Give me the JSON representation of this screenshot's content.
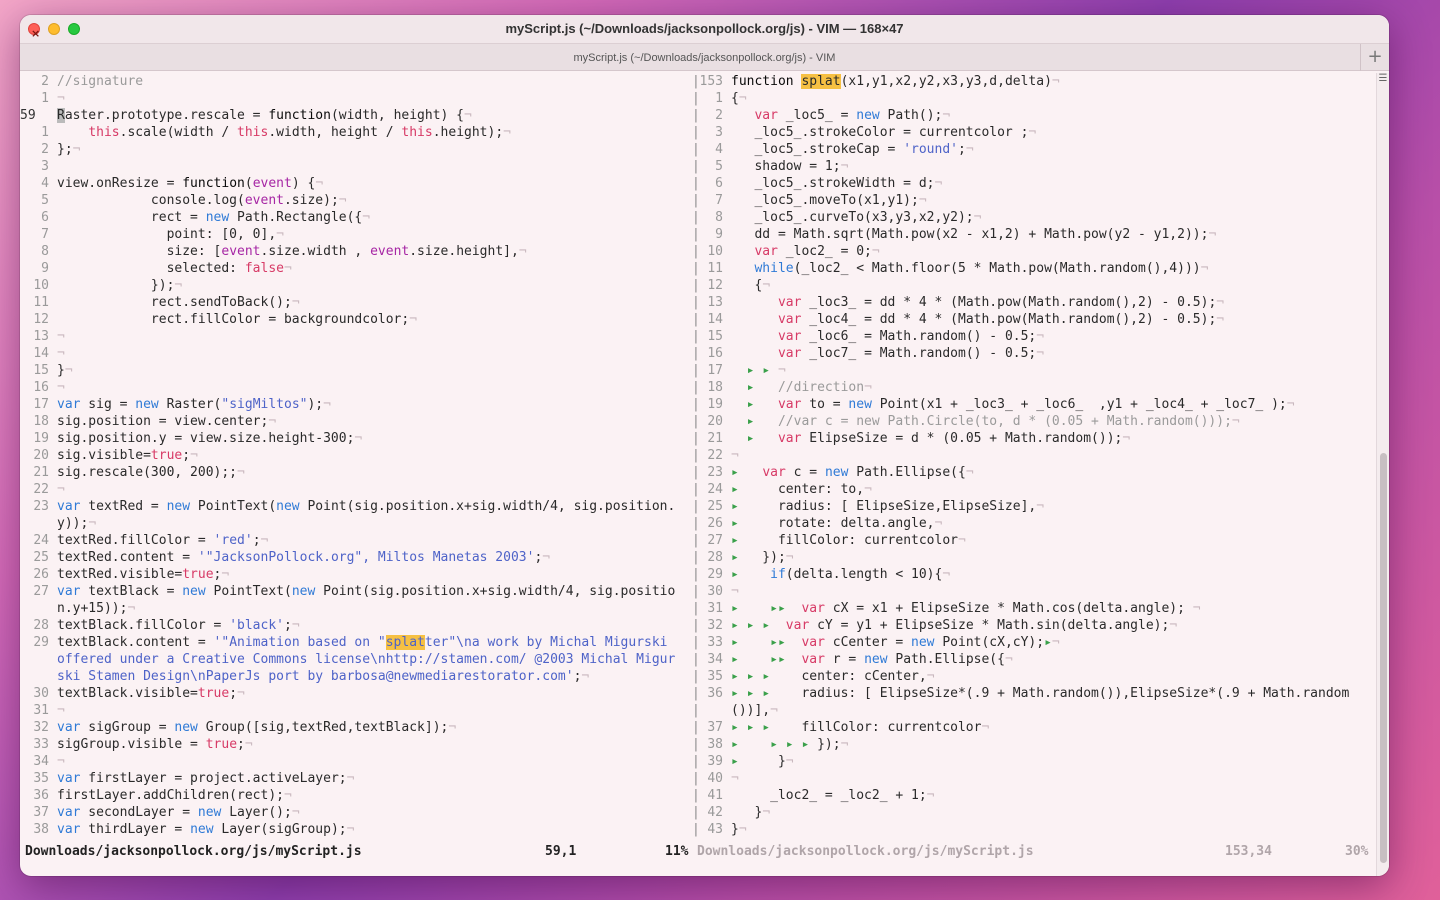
{
  "window": {
    "title": "myScript.js (~/Downloads/jacksonpollock.org/js) - VIM — 168×47",
    "tab_title": "myScript.js (~/Downloads/jacksonpollock.org/js) - VIM",
    "new_tab": "+"
  },
  "left_pane": [
    {
      "n": "2",
      "html": "<span class=\"cmt\">//signature</span>"
    },
    {
      "n": "1",
      "html": "<span class=\"nt\">¬</span>"
    },
    {
      "n": "59",
      "cur": true,
      "html": "<span class=\"cursor\">R</span>aster.prototype.rescale = <span class=\"kw\">function</span>(width, height) {<span class=\"nt\">¬</span>"
    },
    {
      "n": "1",
      "html": "    <span class=\"red\">this</span>.scale(width / <span class=\"red\">this</span>.width, height / <span class=\"red\">this</span>.height);<span class=\"nt\">¬</span>"
    },
    {
      "n": "2",
      "html": "};<span class=\"nt\">¬</span>"
    },
    {
      "n": "3",
      "html": ""
    },
    {
      "n": "4",
      "html": "view.onResize = <span class=\"kw\">function</span>(<span class=\"kw2\">event</span>) {<span class=\"nt\">¬</span>"
    },
    {
      "n": "5",
      "html": "            console.log(<span class=\"kw2\">event</span>.size);<span class=\"nt\">¬</span>"
    },
    {
      "n": "6",
      "html": "            rect = <span class=\"blue\">new</span> Path.Rectangle({<span class=\"nt\">¬</span>"
    },
    {
      "n": "7",
      "html": "              point: [0, 0],<span class=\"nt\">¬</span>"
    },
    {
      "n": "8",
      "html": "              size: [<span class=\"kw2\">event</span>.size.width , <span class=\"kw2\">event</span>.size.height],<span class=\"nt\">¬</span>"
    },
    {
      "n": "9",
      "html": "              selected: <span class=\"red\">false</span><span class=\"nt\">¬</span>"
    },
    {
      "n": "10",
      "html": "            });<span class=\"nt\">¬</span>"
    },
    {
      "n": "11",
      "html": "            rect.sendToBack();<span class=\"nt\">¬</span>"
    },
    {
      "n": "12",
      "html": "            rect.fillColor = backgroundcolor;<span class=\"nt\">¬</span>"
    },
    {
      "n": "13",
      "html": "<span class=\"nt\">¬</span>"
    },
    {
      "n": "14",
      "html": "<span class=\"nt\">¬</span>"
    },
    {
      "n": "15",
      "html": "}<span class=\"nt\">¬</span>"
    },
    {
      "n": "16",
      "html": "<span class=\"nt\">¬</span>"
    },
    {
      "n": "17",
      "html": "<span class=\"blue\">var</span> sig = <span class=\"blue\">new</span> Raster(<span class=\"str\">\"sigMiltos\"</span>);<span class=\"nt\">¬</span>"
    },
    {
      "n": "18",
      "html": "sig.position = view.center;<span class=\"nt\">¬</span>"
    },
    {
      "n": "19",
      "html": "sig.position.y = view.size.height-300;<span class=\"nt\">¬</span>"
    },
    {
      "n": "20",
      "html": "sig.visible=<span class=\"red\">true</span>;<span class=\"nt\">¬</span>"
    },
    {
      "n": "21",
      "html": "sig.rescale(300, 200);;<span class=\"nt\">¬</span>"
    },
    {
      "n": "22",
      "html": "<span class=\"nt\">¬</span>"
    },
    {
      "n": "23",
      "html": "<span class=\"blue\">var</span> textRed = <span class=\"blue\">new</span> PointText(<span class=\"blue\">new</span> Point(sig.position.x+sig.width/4, sig.position."
    },
    {
      "n": "",
      "html": "y));<span class=\"nt\">¬</span>"
    },
    {
      "n": "24",
      "html": "textRed.fillColor = <span class=\"str\">'red'</span>;<span class=\"nt\">¬</span>"
    },
    {
      "n": "25",
      "html": "textRed.content = <span class=\"str\">'\"JacksonPollock.org\", Miltos Manetas 2003'</span>;<span class=\"nt\">¬</span>"
    },
    {
      "n": "26",
      "html": "textRed.visible=<span class=\"red\">true</span>;<span class=\"nt\">¬</span>"
    },
    {
      "n": "27",
      "html": "<span class=\"blue\">var</span> textBlack = <span class=\"blue\">new</span> PointText(<span class=\"blue\">new</span> Point(sig.position.x+sig.width/4, sig.positio"
    },
    {
      "n": "",
      "html": "n.y+15));<span class=\"nt\">¬</span>"
    },
    {
      "n": "28",
      "html": "textBlack.fillColor = <span class=\"str\">'black'</span>;<span class=\"nt\">¬</span>"
    },
    {
      "n": "29",
      "html": "textBlack.content = <span class=\"str\">'\"Animation based on \"<span class=\"hl\">splat</span>ter\"\\na work by Michal Migurski</span>"
    },
    {
      "n": "",
      "html": "<span class=\"str\">offered under a Creative Commons license\\nhttp://stamen.com/ @2003 Michal Migur</span>"
    },
    {
      "n": "",
      "html": "<span class=\"str\">ski Stamen Design\\nPaperJs port by barbosa@newmediarestorator.com'</span>;<span class=\"nt\">¬</span>"
    },
    {
      "n": "30",
      "html": "textBlack.visible=<span class=\"red\">true</span>;<span class=\"nt\">¬</span>"
    },
    {
      "n": "31",
      "html": "<span class=\"nt\">¬</span>"
    },
    {
      "n": "32",
      "html": "<span class=\"blue\">var</span> sigGroup = <span class=\"blue\">new</span> Group([sig,textRed,textBlack]);<span class=\"nt\">¬</span>"
    },
    {
      "n": "33",
      "html": "sigGroup.visible = <span class=\"red\">true</span>;<span class=\"nt\">¬</span>"
    },
    {
      "n": "34",
      "html": "<span class=\"nt\">¬</span>"
    },
    {
      "n": "35",
      "html": "<span class=\"blue\">var</span> firstLayer = project.activeLayer;<span class=\"nt\">¬</span>"
    },
    {
      "n": "36",
      "html": "firstLayer.addChildren(rect);<span class=\"nt\">¬</span>"
    },
    {
      "n": "37",
      "html": "<span class=\"blue\">var</span> secondLayer = <span class=\"blue\">new</span> Layer();<span class=\"nt\">¬</span>"
    },
    {
      "n": "38",
      "html": "<span class=\"blue\">var</span> thirdLayer = <span class=\"blue\">new</span> Layer(sigGroup);<span class=\"nt\">¬</span>"
    }
  ],
  "right_pane": [
    {
      "n": "153",
      "html": "<span class=\"kw\">function</span> <span class=\"hl\">splat</span>(x1,y1,x2,y2,x3,y3,d,delta)<span class=\"nt\">¬</span>"
    },
    {
      "n": "1",
      "html": "{<span class=\"nt\">¬</span>"
    },
    {
      "n": "2",
      "html": "   <span class=\"red\">var</span> _loc5_ = <span class=\"blue\">new</span> Path();<span class=\"nt\">¬</span>"
    },
    {
      "n": "3",
      "html": "   _loc5_.strokeColor = currentcolor ;<span class=\"nt\">¬</span>"
    },
    {
      "n": "4",
      "html": "   _loc5_.strokeCap = <span class=\"str\">'round'</span>;<span class=\"nt\">¬</span>"
    },
    {
      "n": "5",
      "html": "   shadow = 1;<span class=\"nt\">¬</span>"
    },
    {
      "n": "6",
      "html": "   _loc5_.strokeWidth = d;<span class=\"nt\">¬</span>"
    },
    {
      "n": "7",
      "html": "   _loc5_.moveTo(x1,y1);<span class=\"nt\">¬</span>"
    },
    {
      "n": "8",
      "html": "   _loc5_.curveTo(x3,y3,x2,y2);<span class=\"nt\">¬</span>"
    },
    {
      "n": "9",
      "html": "   dd = Math.sqrt(Math.pow(x2 - x1,2) + Math.pow(y2 - y1,2));<span class=\"nt\">¬</span>"
    },
    {
      "n": "10",
      "html": "   <span class=\"red\">var</span> _loc2_ = 0;<span class=\"nt\">¬</span>"
    },
    {
      "n": "11",
      "html": "   <span class=\"blue\">while</span>(_loc2_ &lt; Math.floor(5 * Math.pow(Math.random(),4)))<span class=\"nt\">¬</span>"
    },
    {
      "n": "12",
      "html": "   {<span class=\"nt\">¬</span>"
    },
    {
      "n": "13",
      "html": "      <span class=\"red\">var</span> _loc3_ = dd * 4 * (Math.pow(Math.random(),2) - 0.5);<span class=\"nt\">¬</span>"
    },
    {
      "n": "14",
      "html": "      <span class=\"red\">var</span> _loc4_ = dd * 4 * (Math.pow(Math.random(),2) - 0.5);<span class=\"nt\">¬</span>"
    },
    {
      "n": "15",
      "html": "      <span class=\"red\">var</span> _loc6_ = Math.random() - 0.5;<span class=\"nt\">¬</span>"
    },
    {
      "n": "16",
      "html": "      <span class=\"red\">var</span> _loc7_ = Math.random() - 0.5;<span class=\"nt\">¬</span>"
    },
    {
      "n": "17",
      "html": "  <span class=\"gr\">▸ ▸</span> <span class=\"nt\">¬</span>"
    },
    {
      "n": "18",
      "html": "  <span class=\"gr\">▸</span>   <span class=\"cmt\">//direction</span><span class=\"nt\">¬</span>"
    },
    {
      "n": "19",
      "html": "  <span class=\"gr\">▸</span>   <span class=\"red\">var</span> to = <span class=\"blue\">new</span> Point(x1 + _loc3_ + _loc6_  ,y1 + _loc4_ + _loc7_ );<span class=\"nt\">¬</span>"
    },
    {
      "n": "20",
      "html": "  <span class=\"gr\">▸</span>   <span class=\"cmt\">//var c = new Path.Circle(to, d * (0.05 + Math.random()));</span><span class=\"nt\">¬</span>"
    },
    {
      "n": "21",
      "html": "  <span class=\"gr\">▸</span>   <span class=\"red\">var</span> ElipseSize = d * (0.05 + Math.random());<span class=\"nt\">¬</span>"
    },
    {
      "n": "22",
      "html": "<span class=\"nt\">¬</span>"
    },
    {
      "n": "23",
      "html": "<span class=\"gr\">▸</span>   <span class=\"red\">var</span> c = <span class=\"blue\">new</span> Path.Ellipse({<span class=\"nt\">¬</span>"
    },
    {
      "n": "24",
      "html": "<span class=\"gr\">▸</span>     center: to,<span class=\"nt\">¬</span>"
    },
    {
      "n": "25",
      "html": "<span class=\"gr\">▸</span>     radius: [ ElipseSize,ElipseSize],<span class=\"nt\">¬</span>"
    },
    {
      "n": "26",
      "html": "<span class=\"gr\">▸</span>     rotate: delta.angle,<span class=\"nt\">¬</span>"
    },
    {
      "n": "27",
      "html": "<span class=\"gr\">▸</span>     fillColor: currentcolor<span class=\"nt\">¬</span>"
    },
    {
      "n": "28",
      "html": "<span class=\"gr\">▸</span>   });<span class=\"nt\">¬</span>"
    },
    {
      "n": "29",
      "html": "<span class=\"gr\">▸</span>    <span class=\"blue\">if</span>(delta.length &lt; 10){<span class=\"nt\">¬</span>"
    },
    {
      "n": "30",
      "html": "<span class=\"nt\">¬</span>"
    },
    {
      "n": "31",
      "html": "<span class=\"gr\">▸</span>    <span class=\"gr\">▸▸</span>  <span class=\"red\">var</span> cX = x1 + ElipseSize * Math.cos(delta.angle); <span class=\"nt\">¬</span>"
    },
    {
      "n": "32",
      "html": "<span class=\"gr\">▸ ▸ ▸</span>  <span class=\"red\">var</span> cY = y1 + ElipseSize * Math.sin(delta.angle);<span class=\"nt\">¬</span>"
    },
    {
      "n": "33",
      "html": "<span class=\"gr\">▸</span>    <span class=\"gr\">▸▸</span>  <span class=\"red\">var</span> cCenter = <span class=\"blue\">new</span> Point(cX,cY);<span class=\"gr\">▸</span><span class=\"nt\">¬</span>"
    },
    {
      "n": "34",
      "html": "<span class=\"gr\">▸</span>    <span class=\"gr\">▸▸</span>  <span class=\"red\">var</span> r = <span class=\"blue\">new</span> Path.Ellipse({<span class=\"nt\">¬</span>"
    },
    {
      "n": "35",
      "html": "<span class=\"gr\">▸ ▸ ▸</span>    center: cCenter,<span class=\"nt\">¬</span>"
    },
    {
      "n": "36",
      "html": "<span class=\"gr\">▸ ▸ ▸</span>    radius: [ ElipseSize*(.9 + Math.random()),ElipseSize*(.9 + Math.random"
    },
    {
      "n": "",
      "html": "())],<span class=\"nt\">¬</span>"
    },
    {
      "n": "37",
      "html": "<span class=\"gr\">▸ ▸ ▸</span>    fillColor: currentcolor<span class=\"nt\">¬</span>"
    },
    {
      "n": "38",
      "html": "<span class=\"gr\">▸</span>    <span class=\"gr\">▸ ▸ ▸</span> });<span class=\"nt\">¬</span>"
    },
    {
      "n": "39",
      "html": "<span class=\"gr\">▸</span>     }<span class=\"nt\">¬</span>"
    },
    {
      "n": "40",
      "html": "<span class=\"nt\">¬</span>"
    },
    {
      "n": "41",
      "html": "     _loc2_ = _loc2_ + 1;<span class=\"nt\">¬</span>"
    },
    {
      "n": "42",
      "html": "   }<span class=\"nt\">¬</span>"
    },
    {
      "n": "43",
      "html": "}<span class=\"nt\">¬</span>"
    }
  ],
  "status": {
    "left_file": "Downloads/jacksonpollock.org/js/myScript.js",
    "left_pos": "59,1",
    "left_pct": "11%",
    "right_file": "Downloads/jacksonpollock.org/js/myScript.js",
    "right_pos": "153,34",
    "right_pct": "30%"
  },
  "colors": {
    "keyword_blue": "#2f7ad6",
    "keyword_red": "#d73a66",
    "string": "#4e63c8",
    "search_highlight": "#f6c043"
  }
}
